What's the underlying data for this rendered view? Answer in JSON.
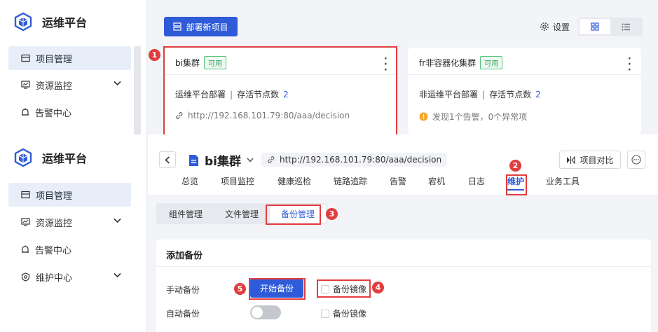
{
  "app": {
    "title": "运维平台"
  },
  "sidebar_top": {
    "items": [
      {
        "label": "项目管理"
      },
      {
        "label": "资源监控"
      },
      {
        "label": "告警中心"
      }
    ]
  },
  "sidebar_bottom": {
    "items": [
      {
        "label": "项目管理"
      },
      {
        "label": "资源监控"
      },
      {
        "label": "告警中心"
      },
      {
        "label": "维护中心"
      }
    ]
  },
  "toolbar": {
    "deploy_label": "部署新项目",
    "settings_label": "设置"
  },
  "cards": [
    {
      "title": "bi集群",
      "badge": "可用",
      "deploy_type": "运维平台部署",
      "sep": "|",
      "nodes_label": "存活节点数",
      "nodes_count": "2",
      "url": "http://192.168.101.79:80/aaa/decision"
    },
    {
      "title": "fr非容器化集群",
      "badge": "可用",
      "deploy_type": "非运维平台部署",
      "sep": "|",
      "nodes_label": "存活节点数",
      "nodes_count": "2",
      "warning": "发现1个告警，0个异常项"
    }
  ],
  "project": {
    "title": "bi集群",
    "url": "http://192.168.101.79:80/aaa/decision",
    "compare_label": "项目对比"
  },
  "tabs": [
    "总览",
    "项目监控",
    "健康巡检",
    "链路追踪",
    "告警",
    "宕机",
    "日志",
    "维护",
    "业务工具"
  ],
  "sub_tabs": [
    "组件管理",
    "文件管理",
    "备份管理"
  ],
  "backup": {
    "title": "添加备份",
    "manual_label": "手动备份",
    "start_label": "开始备份",
    "mirror_label": "备份镜像",
    "auto_label": "自动备份",
    "auto_mirror_label": "备份镜像",
    "auto_enabled": false
  },
  "callouts": [
    "1",
    "2",
    "3",
    "4",
    "5"
  ],
  "colors": {
    "primary": "#2f5bd8",
    "callout": "#e23d3d",
    "ok": "#2e9a57",
    "warn": "#f5a623"
  }
}
